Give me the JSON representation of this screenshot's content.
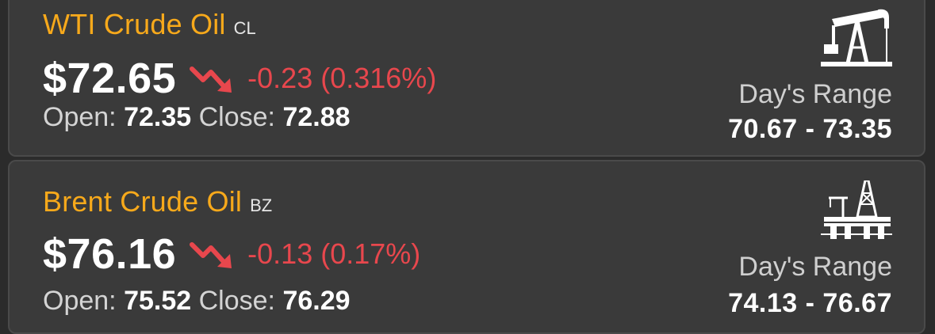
{
  "colors": {
    "background": "#2b2b2b",
    "card": "#3a3a3a",
    "name_accent": "#f7a91b",
    "negative": "#e8474d",
    "text_primary": "#ffffff",
    "text_secondary": "#d4d4d4"
  },
  "commodities": [
    {
      "name": "WTI Crude Oil",
      "symbol": "CL",
      "price": "$72.65",
      "trend_icon": "trend-down-icon",
      "change": "-0.23 (0.316%)",
      "open_label": "Open:",
      "open": "72.35",
      "close_label": "Close:",
      "close": "72.88",
      "facility_icon": "pumpjack-icon",
      "range_label": "Day's Range",
      "range": "70.67 - 73.35"
    },
    {
      "name": "Brent Crude Oil",
      "symbol": "BZ",
      "price": "$76.16",
      "trend_icon": "trend-down-icon",
      "change": "-0.13 (0.17%)",
      "open_label": "Open:",
      "open": "75.52",
      "close_label": "Close:",
      "close": "76.29",
      "facility_icon": "offshore-rig-icon",
      "range_label": "Day's Range",
      "range": "74.13 - 76.67"
    }
  ]
}
